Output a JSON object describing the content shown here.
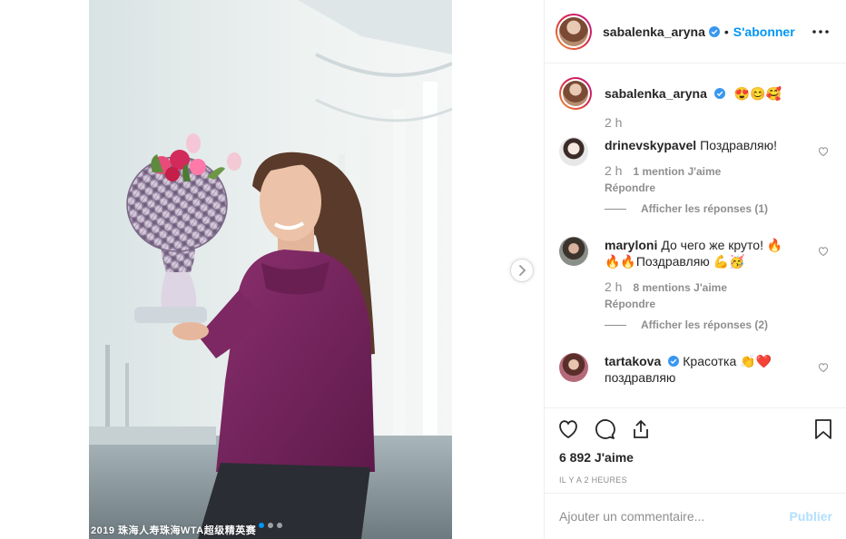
{
  "post": {
    "username": "sabalenka_aryna",
    "follow_label": "S'abonner",
    "separator": "•",
    "caption_emoji": "😍😊🥰",
    "caption_time": "2 h",
    "watermark": "2019 珠海人寿珠海WTA超级精英赛",
    "slide_count": 3,
    "active_slide": 1
  },
  "comments": [
    {
      "username": "drinevskypavel",
      "text": "Поздравляю!",
      "time": "2 h",
      "likes": "1 mention J'aime",
      "reply": "Répondre",
      "view_replies": "Afficher les réponses (1)"
    },
    {
      "username": "maryloni",
      "text": "До чего же круто! 🔥🔥🔥Поздравляю 💪🥳",
      "time": "2 h",
      "likes": "8 mentions J'aime",
      "reply": "Répondre",
      "view_replies": "Afficher les réponses (2)"
    },
    {
      "username": "tartakova",
      "text": "Красотка 👏❤️ поздравляю",
      "verified": true
    }
  ],
  "footer": {
    "likes_text": "6 892 J'aime",
    "time_ago": "IL Y A 2 HEURES",
    "comment_placeholder": "Ajouter un commentaire...",
    "publish_label": "Publier"
  },
  "colors": {
    "accent": "#0095f6",
    "publish_disabled": "#b2dffc",
    "text_secondary": "#8e8e8e",
    "sweater": "#7b2560"
  },
  "icons": [
    "verified-icon",
    "more-options-icon",
    "heart-icon",
    "comment-icon",
    "share-icon",
    "bookmark-icon",
    "chevron-right-icon"
  ]
}
